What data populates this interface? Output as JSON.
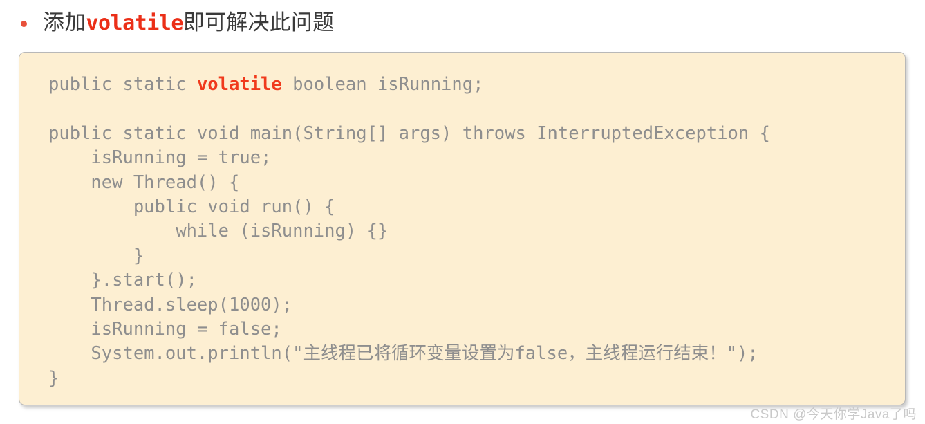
{
  "heading": {
    "bullet_icon": "bullet-dot-icon",
    "bullet_color": "#e8503a",
    "text_before": "添加",
    "keyword": "volatile",
    "keyword_color": "#eb2f18",
    "text_after": "即可解决此问题",
    "full_text": "添加volatile即可解决此问题"
  },
  "code_block": {
    "background_color": "#fdefd2",
    "border_color": "#b8b8b8",
    "text_color": "#8e8e8e",
    "keyword_color": "#f03a1c",
    "language": "java",
    "highlighted_keyword": "volatile",
    "lines": [
      "public static volatile boolean isRunning;",
      "",
      "public static void main(String[] args) throws InterruptedException {",
      "    isRunning = true;",
      "    new Thread() {",
      "        public void run() {",
      "            while (isRunning) {}",
      "        }",
      "    }.start();",
      "    Thread.sleep(1000);",
      "    isRunning = false;",
      "    System.out.println(\"主线程已将循环变量设置为false，主线程运行结束！\");",
      "}"
    ],
    "segment_1": "public static ",
    "segment_keyword": "volatile",
    "segment_2": " boolean isRunning;\n\npublic static void main(String[] args) throws InterruptedException {\n    isRunning = true;\n    new Thread() {\n        public void run() {\n            while (isRunning) {}\n        }\n    }.start();\n    Thread.sleep(1000);\n    isRunning = false;\n    System.out.println(\"主线程已将循环变量设置为false，主线程运行结束！\");\n}"
  },
  "watermark": {
    "text": "CSDN @今天你学Java了吗"
  }
}
